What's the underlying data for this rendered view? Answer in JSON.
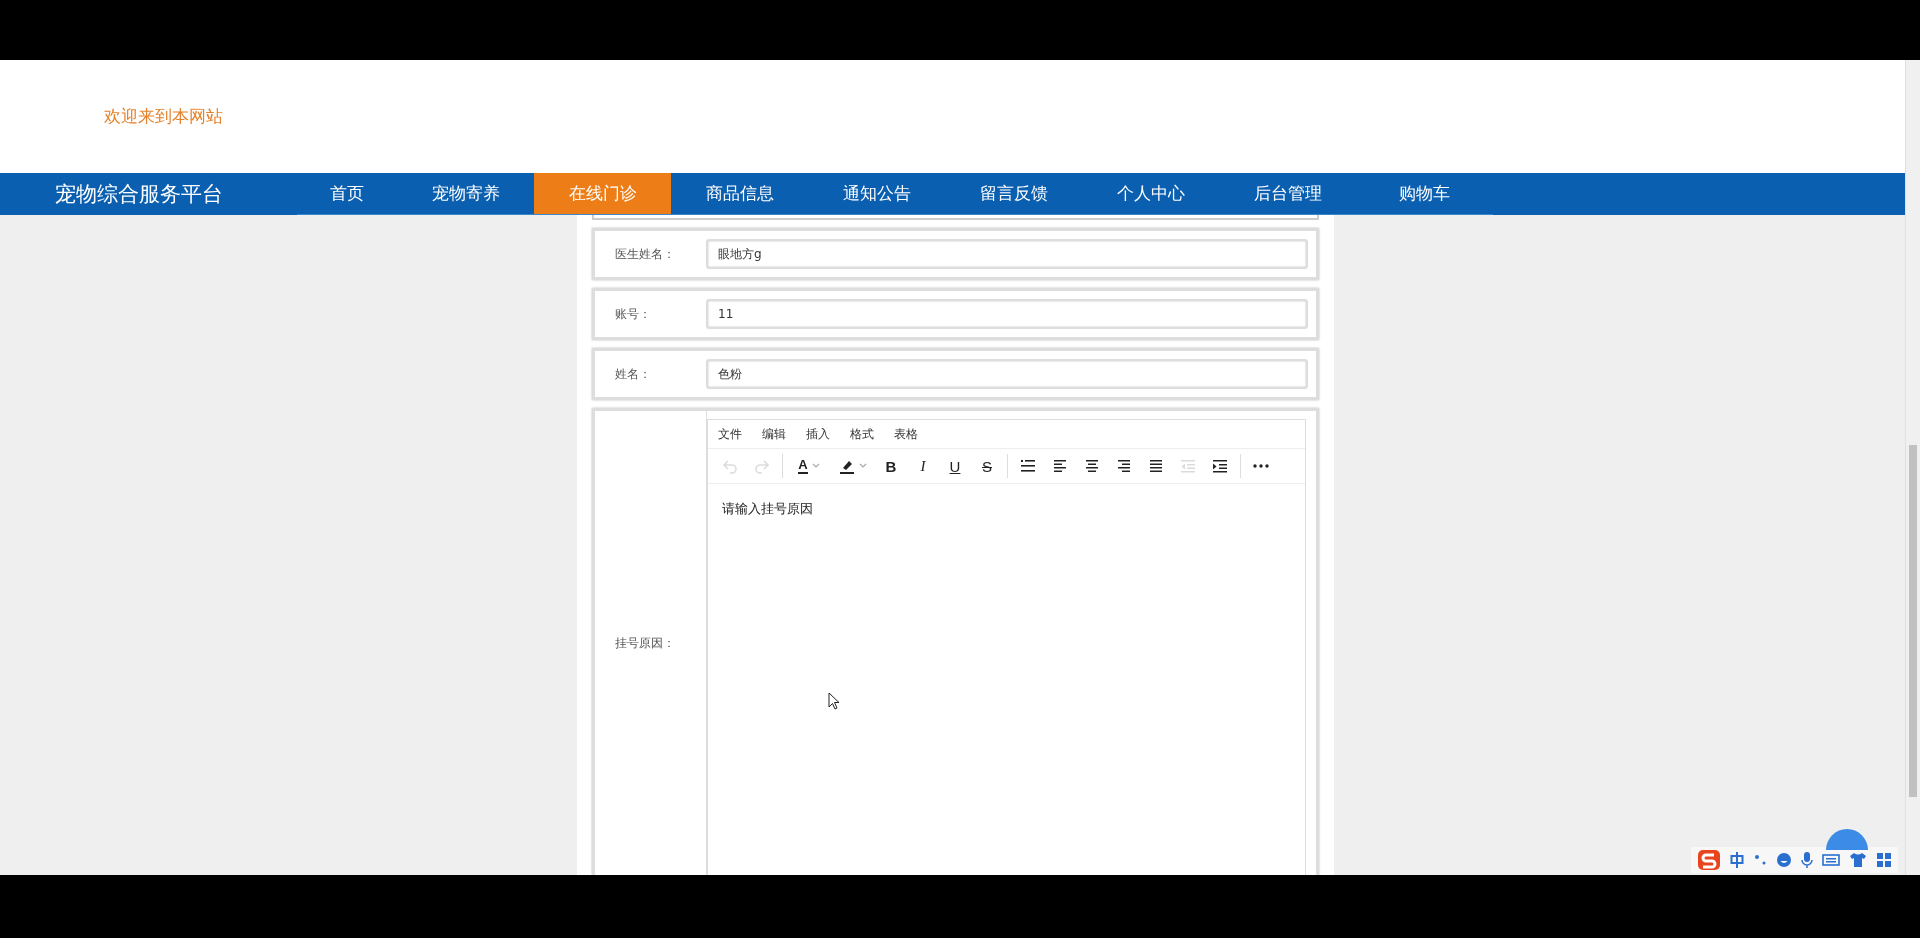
{
  "header": {
    "welcome": "欢迎来到本网站"
  },
  "nav": {
    "brand": "宠物综合服务平台",
    "items": [
      {
        "label": "首页",
        "selected": false
      },
      {
        "label": "宠物寄养",
        "selected": false
      },
      {
        "label": "在线门诊",
        "selected": true
      },
      {
        "label": "商品信息",
        "selected": false
      },
      {
        "label": "通知公告",
        "selected": false
      },
      {
        "label": "留言反馈",
        "selected": false
      },
      {
        "label": "个人中心",
        "selected": false
      },
      {
        "label": "后台管理",
        "selected": false
      },
      {
        "label": "购物车",
        "selected": false
      }
    ]
  },
  "form": {
    "fields": [
      {
        "label": "医生姓名：",
        "value": "眼地方g"
      },
      {
        "label": "账号：",
        "value": "11"
      },
      {
        "label": "姓名：",
        "value": "色粉"
      }
    ],
    "editor": {
      "label": "挂号原因：",
      "menu": [
        "文件",
        "编辑",
        "插入",
        "格式",
        "表格"
      ],
      "tools": [
        {
          "kind": "undo",
          "disabled": true
        },
        {
          "kind": "redo",
          "disabled": true
        },
        {
          "kind": "separator"
        },
        {
          "kind": "forecolor",
          "glyph": "A",
          "disabled": false
        },
        {
          "kind": "highlight",
          "disabled": false
        },
        {
          "kind": "bold",
          "glyph": "B",
          "disabled": false
        },
        {
          "kind": "italic",
          "glyph": "I",
          "disabled": false
        },
        {
          "kind": "underline",
          "glyph": "U",
          "disabled": false
        },
        {
          "kind": "strike",
          "glyph": "S",
          "disabled": false
        },
        {
          "kind": "separator"
        },
        {
          "kind": "list",
          "disabled": false
        },
        {
          "kind": "align-left",
          "disabled": false
        },
        {
          "kind": "align-center",
          "disabled": false
        },
        {
          "kind": "align-right",
          "disabled": false
        },
        {
          "kind": "justify",
          "disabled": false
        },
        {
          "kind": "outdent",
          "disabled": true
        },
        {
          "kind": "indent",
          "disabled": false
        },
        {
          "kind": "separator"
        },
        {
          "kind": "more",
          "disabled": false
        }
      ],
      "placeholder": "请输入挂号原因"
    }
  }
}
